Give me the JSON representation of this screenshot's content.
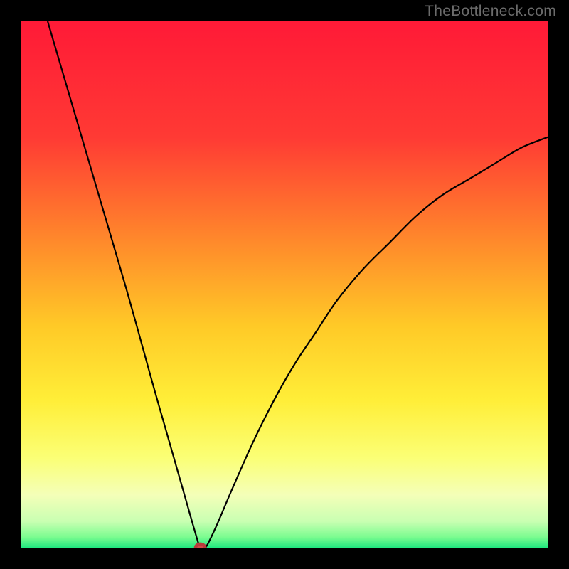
{
  "watermark": "TheBottleneck.com",
  "chart_data": {
    "type": "line",
    "title": "",
    "xlabel": "",
    "ylabel": "",
    "xlim": [
      0,
      100
    ],
    "ylim": [
      0,
      100
    ],
    "gradient_stops": [
      {
        "offset": 0,
        "color": "#ff1a37"
      },
      {
        "offset": 22,
        "color": "#ff3a34"
      },
      {
        "offset": 42,
        "color": "#ff8a2b"
      },
      {
        "offset": 58,
        "color": "#ffca27"
      },
      {
        "offset": 72,
        "color": "#ffee38"
      },
      {
        "offset": 83,
        "color": "#fbff76"
      },
      {
        "offset": 90,
        "color": "#f4ffb8"
      },
      {
        "offset": 95,
        "color": "#c9ffb2"
      },
      {
        "offset": 98,
        "color": "#7bfc90"
      },
      {
        "offset": 100,
        "color": "#20e77f"
      }
    ],
    "series": [
      {
        "name": "bottleneck-curve",
        "x": [
          5,
          10,
          15,
          20,
          25,
          27,
          29,
          31,
          33,
          34,
          35,
          37,
          40,
          44,
          48,
          52,
          56,
          60,
          65,
          70,
          75,
          80,
          85,
          90,
          95,
          100
        ],
        "y": [
          100,
          83,
          66,
          49,
          31,
          24,
          17,
          10,
          3,
          0,
          0,
          4,
          11,
          20,
          28,
          35,
          41,
          47,
          53,
          58,
          63,
          67,
          70,
          73,
          76,
          78
        ]
      }
    ],
    "marker": {
      "x": 34,
      "y": 0,
      "rx": 0.9,
      "ry": 0.7
    }
  }
}
